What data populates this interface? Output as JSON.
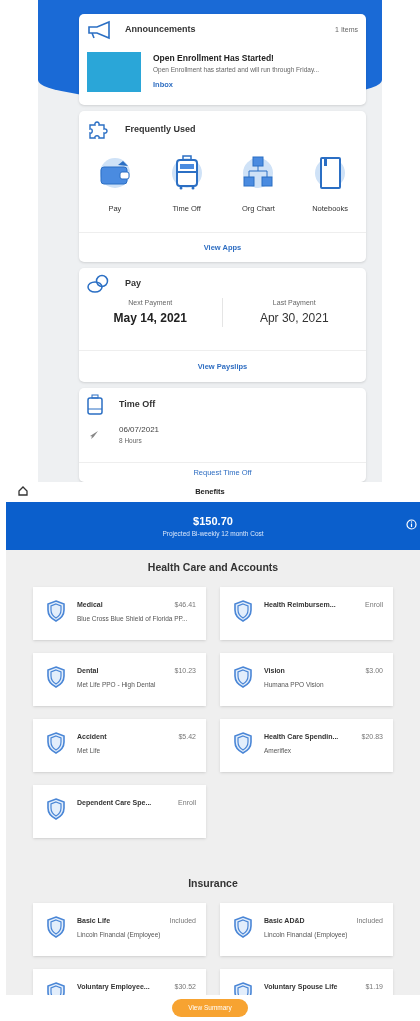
{
  "announcements": {
    "title": "Announcements",
    "count": "1 Items",
    "item": {
      "title": "Open Enrollment Has Started!",
      "body": "Open Enrollment has started and will run through Friday...",
      "link": "Inbox"
    }
  },
  "frequently_used": {
    "title": "Frequently Used",
    "apps": [
      {
        "label": "Pay",
        "kind": "wallet"
      },
      {
        "label": "Time Off",
        "kind": "suitcase"
      },
      {
        "label": "Org Chart",
        "kind": "org"
      },
      {
        "label": "Notebooks",
        "kind": "notebook"
      }
    ],
    "link": "View Apps"
  },
  "pay": {
    "title": "Pay",
    "next_label": "Next Payment",
    "next_date": "May 14, 2021",
    "last_label": "Last Payment",
    "last_date": "Apr 30, 2021",
    "link": "View Payslips"
  },
  "time_off": {
    "title": "Time Off",
    "date": "06/07/2021",
    "hours": "8 Hours",
    "link": "Request Time Off"
  },
  "benefits": {
    "title": "Benefits",
    "amount": "$150.70",
    "caption": "Projected Bi-weekly 12 month Cost",
    "sections": [
      {
        "title": "Health Care and Accounts",
        "plans": [
          {
            "name": "Medical",
            "price": "$46.41",
            "provider": "Blue Cross Blue Shield of Florida PP..."
          },
          {
            "name": "Health Reimbursem...",
            "price": "Enroll"
          },
          {
            "name": "Dental",
            "price": "$10.23",
            "provider": "Met Life PPO - High Dental"
          },
          {
            "name": "Vision",
            "price": "$3.00",
            "provider": "Humana PPO Vision"
          },
          {
            "name": "Accident",
            "price": "$5.42",
            "provider": "Met Life"
          },
          {
            "name": "Health Care Spendin...",
            "price": "$20.83",
            "provider": "Ameriflex"
          },
          {
            "name": "Dependent Care Spe...",
            "price": "Enroll"
          }
        ]
      },
      {
        "title": "Insurance",
        "plans": [
          {
            "name": "Basic Life",
            "price": "Included",
            "provider": "Lincoln Financial  (Employee)"
          },
          {
            "name": "Basic AD&D",
            "price": "Included",
            "provider": "Lincoln Financial  (Employee)"
          },
          {
            "name": "Voluntary Employee...",
            "price": "$30.52"
          },
          {
            "name": "Voluntary Spouse Life",
            "price": "$1.19"
          }
        ]
      }
    ],
    "button": "View Summary"
  }
}
